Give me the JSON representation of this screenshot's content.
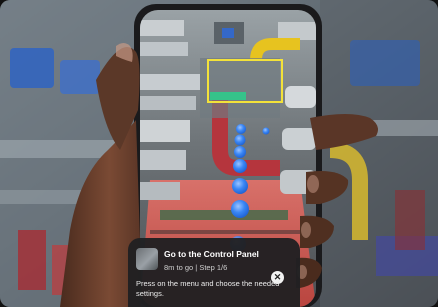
{
  "instruction_card": {
    "title": "Go to the Control Panel",
    "distance": "8m to go",
    "step": "Step 1/6",
    "separator": "|",
    "description": "Press on the menu and choose the needed settings.",
    "close_icon": "close-icon",
    "thumbnail_icon": "control-panel-thumbnail"
  },
  "colors": {
    "path_marker": "#2f7cf0",
    "highlight_box": "#f3e23a",
    "pipe_red": "#b5353d",
    "pipe_yellow": "#e6c21f",
    "floor_red": "#c9564c"
  }
}
